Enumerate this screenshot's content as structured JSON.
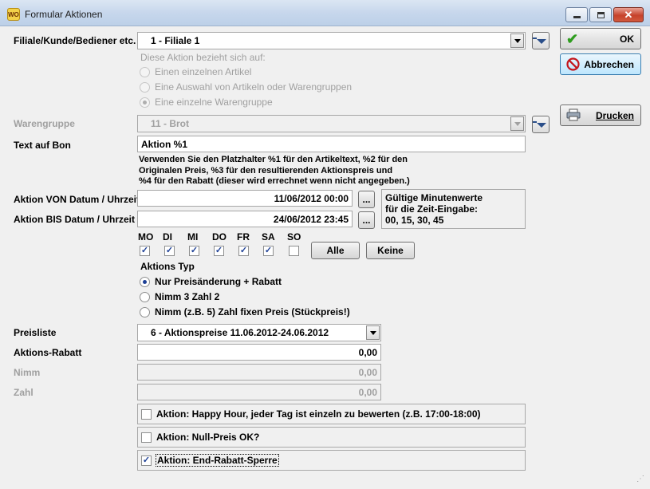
{
  "window": {
    "title": "Formular Aktionen",
    "icon_text": "WO"
  },
  "fields": {
    "filiale_label": "Filiale/Kunde/Bediener etc.",
    "filiale_value": "1 - Filiale 1",
    "bezieht_label": "Diese Aktion bezieht sich auf:",
    "scope_options": [
      "Einen einzelnen Artikel",
      "Eine Auswahl von Artikeln oder Warengruppen",
      "Eine einzelne Warengruppe"
    ],
    "warengruppe_label": "Warengruppe",
    "warengruppe_value": "11 - Brot",
    "text_bon_label": "Text auf Bon",
    "text_bon_value": "Aktion %1",
    "hint_lines": [
      "Verwenden Sie den Platzhalter %1 für den Artikeltext, %2 für den",
      "Originalen Preis, %3 für den resultierenden Aktionspreis und",
      "%4 für den Rabatt (dieser wird errechnet wenn nicht angegeben.)"
    ],
    "von_label": "Aktion VON Datum / Uhrzeit",
    "von_value": "11/06/2012 00:00",
    "bis_label": "Aktion BIS Datum / Uhrzeit",
    "bis_value": "24/06/2012 23:45",
    "dots_label": "...",
    "minutes_lines": [
      "Gültige Minutenwerte",
      "für die Zeit-Eingabe:",
      "00,  15,  30,  45"
    ],
    "days": [
      {
        "label": "MO",
        "checked": true
      },
      {
        "label": "DI",
        "checked": true
      },
      {
        "label": "MI",
        "checked": true
      },
      {
        "label": "DO",
        "checked": true
      },
      {
        "label": "FR",
        "checked": true
      },
      {
        "label": "SA",
        "checked": true
      },
      {
        "label": "SO",
        "checked": false
      }
    ],
    "alle_label": "Alle",
    "keine_label": "Keine",
    "typ_label": "Aktions Typ",
    "typ_options": [
      "Nur Preisänderung + Rabatt",
      "Nimm 3 Zahl 2",
      "Nimm (z.B. 5) Zahl fixen Preis (Stückpreis!)"
    ],
    "preisliste_label": "Preisliste",
    "preisliste_value": "6 - Aktionspreise 11.06.2012-24.06.2012",
    "rabatt_label": "Aktions-Rabatt",
    "rabatt_value": "0,00",
    "nimm_label": "Nimm",
    "nimm_value": "0,00",
    "zahl_label": "Zahl",
    "zahl_value": "0,00",
    "happy_hour_label": "Aktion: Happy Hour, jeder Tag ist einzeln zu bewerten (z.B. 17:00-18:00)",
    "nullpreis_label": "Aktion: Null-Preis OK?",
    "endrabatt_label": "Aktion: End-Rabatt-Sperre"
  },
  "buttons": {
    "ok": "OK",
    "abbrechen": "Abbrechen",
    "drucken": "Drucken"
  },
  "colors": {
    "ok_check": "#2f9d1f",
    "cancel_icon": "#c4161c",
    "radio_dot": "#1c3f95"
  }
}
